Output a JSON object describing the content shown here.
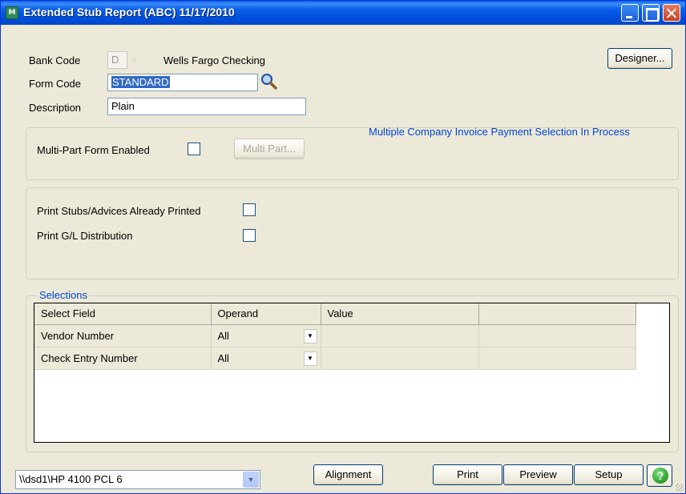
{
  "window": {
    "title": "Extended Stub Report (ABC) 11/17/2010",
    "icon": "mas90-app-icon"
  },
  "form": {
    "bank_code_label": "Bank Code",
    "bank_code_value": "D",
    "bank_name": "Wells Fargo Checking",
    "form_code_label": "Form Code",
    "form_code_value": "STANDARD",
    "description_label": "Description",
    "description_value": "Plain",
    "designer_button": "Designer..."
  },
  "multipart": {
    "note": "Multiple Company Invoice Payment Selection In Process",
    "enabled_label": "Multi-Part Form Enabled",
    "button": "Multi Part..."
  },
  "options": {
    "print_stubs_label": "Print Stubs/Advices Already Printed",
    "print_gl_label": "Print G/L Distribution"
  },
  "selections": {
    "legend": "Selections",
    "columns": [
      "Select Field",
      "Operand",
      "Value",
      ""
    ],
    "rows": [
      {
        "field": "Vendor Number",
        "operand": "All",
        "value": ""
      },
      {
        "field": "Check Entry Number",
        "operand": "All",
        "value": ""
      }
    ]
  },
  "footer": {
    "printer": "\\\\dsd1\\HP 4100 PCL 6",
    "alignment": "Alignment",
    "print": "Print",
    "preview": "Preview",
    "setup": "Setup",
    "help": "?"
  },
  "colors": {
    "title_blue": "#0a5fe8",
    "accent_text": "#0046d5",
    "face": "#ece9d8"
  }
}
